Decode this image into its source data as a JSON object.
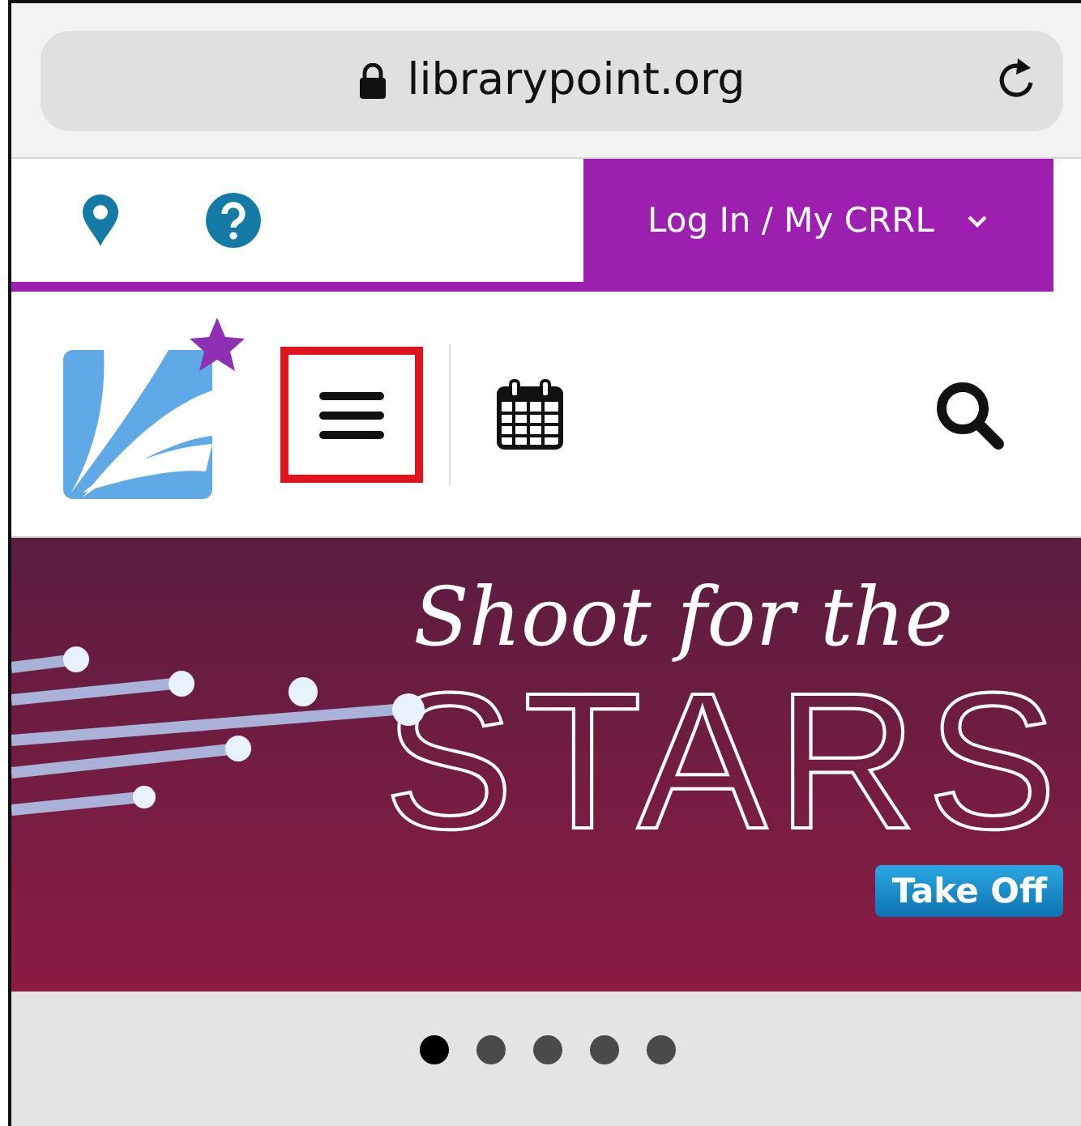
{
  "address_bar": {
    "url": "librarypoint.org"
  },
  "top_bar": {
    "login_button": "Log In / My CRRL"
  },
  "banner": {
    "script_title": "Shoot for the",
    "title": "STARS",
    "button": "Take Off"
  },
  "carousel_dots": [
    {
      "selected": true
    },
    {
      "selected": false
    },
    {
      "selected": false
    },
    {
      "selected": false
    },
    {
      "selected": false
    }
  ]
}
